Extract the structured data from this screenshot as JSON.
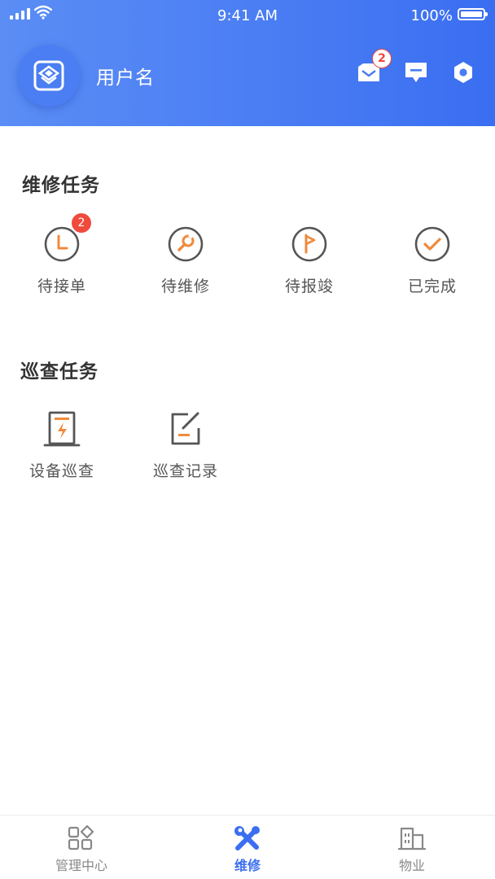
{
  "status_bar": {
    "time": "9:41 AM",
    "battery": "100%"
  },
  "header": {
    "username": "用户名",
    "inbox_badge": "2"
  },
  "colors": {
    "header_start": "#5b8df5",
    "header_end": "#3a6ef1",
    "accent_orange": "#ef8a3c",
    "badge_red": "#ef4a3c",
    "tab_active": "#3b6ef1"
  },
  "repair_section": {
    "title": "维修任务",
    "items": [
      {
        "label": "待接单",
        "icon": "clock-icon",
        "badge": "2"
      },
      {
        "label": "待维修",
        "icon": "wrench-icon"
      },
      {
        "label": "待报竣",
        "icon": "flag-icon"
      },
      {
        "label": "已完成",
        "icon": "check-icon"
      }
    ]
  },
  "patrol_section": {
    "title": "巡查任务",
    "items": [
      {
        "label": "设备巡查",
        "icon": "equipment-icon"
      },
      {
        "label": "巡查记录",
        "icon": "edit-record-icon"
      }
    ]
  },
  "tabbar": {
    "items": [
      {
        "label": "管理中心",
        "icon": "grid-icon"
      },
      {
        "label": "维修",
        "icon": "tools-icon",
        "active": true
      },
      {
        "label": "物业",
        "icon": "building-icon"
      }
    ]
  }
}
